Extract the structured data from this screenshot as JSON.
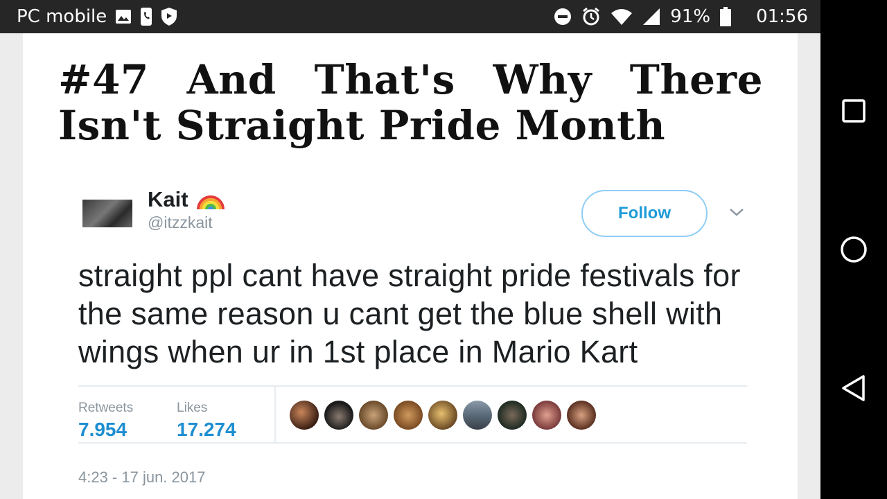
{
  "status_bar": {
    "carrier": "PC mobile",
    "battery": "91%",
    "time": "01:56",
    "icons_left": [
      "image-icon",
      "phone-icon",
      "shield-icon"
    ],
    "icons_right": [
      "do-not-disturb-icon",
      "alarm-icon",
      "wifi-icon",
      "signal-icon",
      "battery-icon"
    ]
  },
  "article": {
    "title": "#47 And That's Why There Isn't Straight Pride Month"
  },
  "tweet": {
    "user_name": "Kait",
    "user_emoji": "rainbow-icon",
    "handle": "@itzzkait",
    "follow_label": "Follow",
    "text": "straight ppl cant have straight pride festivals for the same reason u cant get the blue shell with wings when ur in 1st place in Mario Kart",
    "retweets_label": "Retweets",
    "retweets_value": "7.954",
    "likes_label": "Likes",
    "likes_value": "17.274",
    "timestamp": "4:23 - 17 jun. 2017",
    "liker_avatars": 9
  },
  "nav_bar": {
    "buttons": [
      "recents-square-icon",
      "home-circle-icon",
      "back-triangle-icon"
    ]
  },
  "colors": {
    "status_bar_bg": "#262626",
    "nav_bar_bg": "#000000",
    "twitter_blue": "#1d9bd8",
    "follow_border": "#8fcdf4"
  }
}
